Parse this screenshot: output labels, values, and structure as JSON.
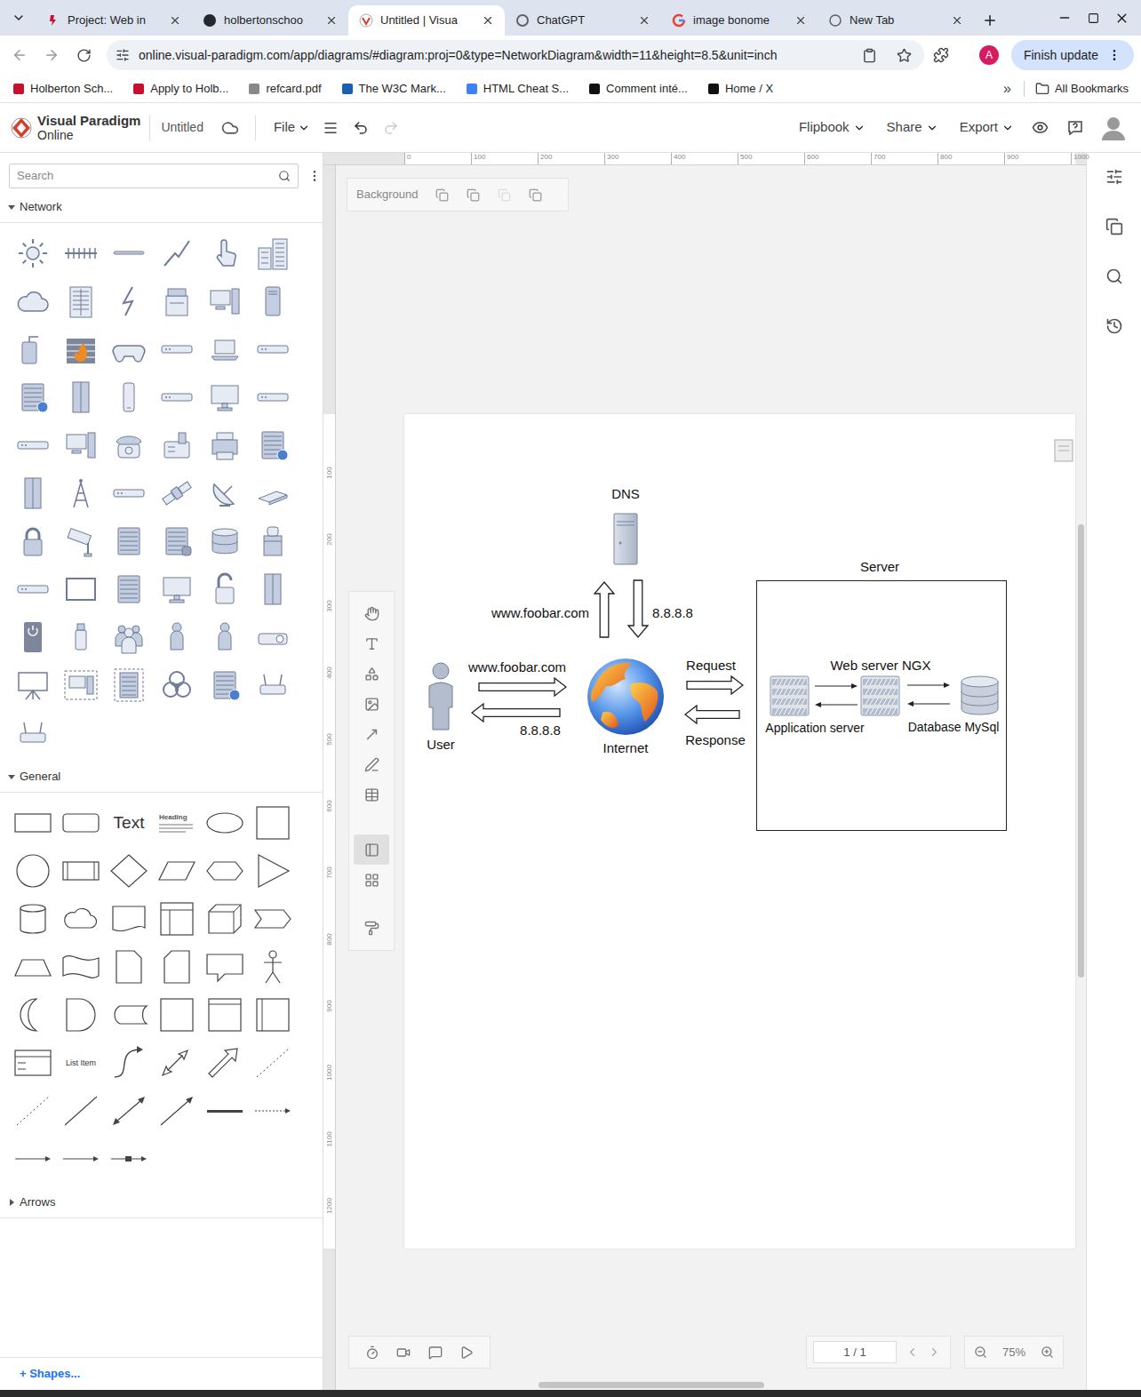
{
  "browser": {
    "tabs": [
      {
        "label": "Project: Web in",
        "selected": false
      },
      {
        "label": "holbertonschoo",
        "selected": false
      },
      {
        "label": "Untitled | Visua",
        "selected": true
      },
      {
        "label": "ChatGPT",
        "selected": false
      },
      {
        "label": "image bonome",
        "selected": false
      },
      {
        "label": "New Tab",
        "selected": false
      }
    ],
    "url": "online.visual-paradigm.com/app/diagrams/#diagram:proj=0&type=NetworkDiagram&width=11&height=8.5&unit=inch",
    "update_button": "Finish update",
    "profile_initial": "A",
    "bookmarks": [
      {
        "label": "Holberton Sch..."
      },
      {
        "label": "Apply to Holb..."
      },
      {
        "label": "refcard.pdf"
      },
      {
        "label": "The W3C Mark..."
      },
      {
        "label": "HTML Cheat S..."
      },
      {
        "label": "Comment inté..."
      },
      {
        "label": "Home / X"
      }
    ],
    "overflow": "»",
    "all_bookmarks": "All Bookmarks"
  },
  "app": {
    "brand": "Visual Paradigm",
    "brand_sub": "Online",
    "title": "Untitled",
    "file_menu": "File",
    "menus": [
      "Flipbook",
      "Share",
      "Export"
    ]
  },
  "sidebar": {
    "search_placeholder": "Search",
    "sections": [
      {
        "title": "Network",
        "expanded": true
      },
      {
        "title": "General",
        "expanded": true
      },
      {
        "title": "Arrows",
        "expanded": false
      }
    ],
    "shape_labels": {
      "text": "Text",
      "heading": "Heading",
      "list_item": "List Item"
    },
    "more_shapes": "+ Shapes..."
  },
  "canvas": {
    "background_label": "Background",
    "ruler_x": [
      "0",
      "100",
      "200",
      "300",
      "400",
      "500",
      "600",
      "700",
      "800",
      "900",
      "1000"
    ],
    "ruler_y": [
      "100",
      "200",
      "300",
      "400",
      "500",
      "600",
      "700",
      "800",
      "900",
      "1000",
      "1100",
      "1200"
    ],
    "tools": [
      {
        "selected": false
      },
      {
        "selected": false
      },
      {
        "selected": false
      },
      {
        "selected": false
      },
      {
        "selected": false
      },
      {
        "selected": false
      },
      {
        "selected": false
      },
      {
        "selected": true
      },
      {
        "selected": false
      },
      {
        "selected": false
      }
    ],
    "page_indicator": "1 / 1",
    "zoom": "75%"
  },
  "diagram": {
    "container": "Server",
    "nodes": [
      {
        "label": "DNS",
        "kind": "dns"
      },
      {
        "label": "User",
        "kind": "user"
      },
      {
        "label": "Internet",
        "kind": "globe"
      },
      {
        "label": "Web server NGX",
        "kind": "server"
      },
      {
        "label": "Application server",
        "kind": "server"
      },
      {
        "label": "Database MySql",
        "kind": "database"
      }
    ],
    "arrows": [
      {
        "label": "www.foobar.com"
      },
      {
        "label": "8.8.8.8"
      },
      {
        "label": "www.foobar.com"
      },
      {
        "label": "8.8.8.8"
      },
      {
        "label": "Request"
      },
      {
        "label": "Response"
      }
    ]
  }
}
